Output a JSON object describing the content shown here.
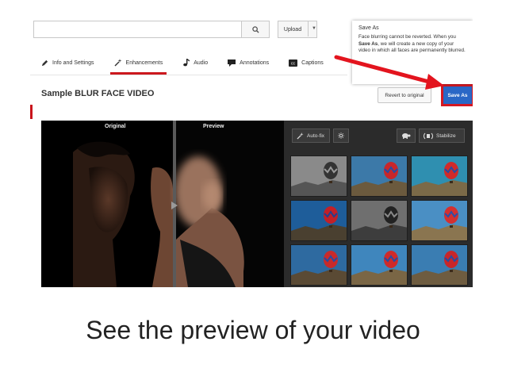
{
  "header": {
    "search_placeholder": "",
    "search_icon": "search-icon",
    "upload_label": "Upload",
    "upload_dropdown_icon": "caret-down-icon"
  },
  "tabs": [
    {
      "label": "Info and Settings",
      "icon": "pencil-icon",
      "active": false
    },
    {
      "label": "Enhancements",
      "icon": "magic-wand-icon",
      "active": true
    },
    {
      "label": "Audio",
      "icon": "music-note-icon",
      "active": false
    },
    {
      "label": "Annotations",
      "icon": "speech-bubble-icon",
      "active": false
    },
    {
      "label": "Captions",
      "icon": "cc-icon",
      "active": false
    }
  ],
  "page": {
    "title": "Sample BLUR FACE VIDEO",
    "revert_label": "Revert to original",
    "save_as_label": "Save As"
  },
  "popup": {
    "title": "Save As",
    "text_before": "Face blurring cannot be reverted. When you ",
    "text_bold": "Save As",
    "text_after": ", we will create a new copy of your video in which all faces are permanently blurred."
  },
  "video": {
    "original_label": "Original",
    "preview_label": "Preview"
  },
  "tools": {
    "autofix_label": "Auto-fix",
    "brightness_icon": "sun-icon",
    "slow_icon": "turtle-icon",
    "stabilize_label": "Stabilize"
  },
  "caption": "See the preview of your video",
  "colors": {
    "accent_red": "#cc181e",
    "save_blue": "#2a67c6",
    "arrow_red": "#e3141e",
    "panel_dark": "#2b2b2b"
  }
}
